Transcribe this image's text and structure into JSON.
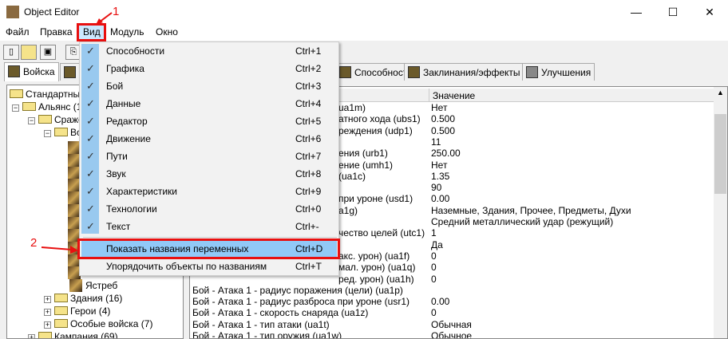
{
  "window": {
    "title": "Object Editor",
    "min": "—",
    "max": "☐",
    "close": "✕"
  },
  "menubar": [
    "Файл",
    "Правка",
    "Вид",
    "Модуль",
    "Окно"
  ],
  "annotations": {
    "one": "1",
    "two": "2"
  },
  "tabs": {
    "units": "Войска",
    "abilities": "Способности",
    "spells": "Заклинания/эффекты",
    "upgrades": "Улучшения"
  },
  "tree": {
    "root": "Стандартные",
    "alliance": "Альянс (1",
    "melee": "Сраже",
    "units": "Во",
    "hawk": "Ястреб",
    "buildings": "Здания (16)",
    "heroes": "Герои (4)",
    "special": "Особые войска (7)",
    "campaign": "Кампания (69)"
  },
  "menu": {
    "items": [
      {
        "label": "Способности",
        "shortcut": "Ctrl+1",
        "checked": true
      },
      {
        "label": "Графика",
        "shortcut": "Ctrl+2",
        "checked": true
      },
      {
        "label": "Бой",
        "shortcut": "Ctrl+3",
        "checked": true
      },
      {
        "label": "Данные",
        "shortcut": "Ctrl+4",
        "checked": true
      },
      {
        "label": "Редактор",
        "shortcut": "Ctrl+5",
        "checked": true
      },
      {
        "label": "Движение",
        "shortcut": "Ctrl+6",
        "checked": true
      },
      {
        "label": "Пути",
        "shortcut": "Ctrl+7",
        "checked": true
      },
      {
        "label": "Звук",
        "shortcut": "Ctrl+8",
        "checked": true
      },
      {
        "label": "Характеристики",
        "shortcut": "Ctrl+9",
        "checked": true
      },
      {
        "label": "Технологии",
        "shortcut": "Ctrl+0",
        "checked": true
      },
      {
        "label": "Текст",
        "shortcut": "Ctrl+-",
        "checked": true
      }
    ],
    "extra": [
      {
        "label": "Показать названия переменных",
        "shortcut": "Ctrl+D"
      },
      {
        "label": "Упорядочить объекты по названиям",
        "shortcut": "Ctrl+T"
      }
    ]
  },
  "grid": {
    "header_value": "Значение",
    "rows": [
      [
        "ua1m)",
        "Нет"
      ],
      [
        "атного хода (ubs1)",
        "0.500"
      ],
      [
        "реждения (udp1)",
        "0.500"
      ],
      [
        "",
        "11"
      ],
      [
        "ения (urb1)",
        "250.00"
      ],
      [
        "ение (umh1)",
        "Нет"
      ],
      [
        "(ua1c)",
        "1.35"
      ],
      [
        "",
        "90"
      ],
      [
        "при уроне (usd1)",
        "0.00"
      ],
      [
        "a1g)",
        "Наземные, Здания, Прочее, Предметы, Духи"
      ],
      [
        "",
        "Средний металлический удар (режущий)"
      ],
      [
        "чество целей (utc1)",
        "1"
      ],
      [
        "",
        "Да"
      ],
      [
        "акс. урон) (ua1f)",
        "0"
      ],
      [
        "мал. урон) (ua1q)",
        "0"
      ],
      [
        "ред. урон) (ua1h)",
        "0"
      ],
      [
        "Бой - Атака 1 - радиус поражения (цели) (ua1p)",
        ""
      ],
      [
        "Бой - Атака 1 - радиус разброса при уроне (usr1)",
        "0.00"
      ],
      [
        "Бой - Атака 1 - скорость снаряда (ua1z)",
        "0"
      ],
      [
        "Бой - Атака 1 - тип атаки (ua1t)",
        "Обычная"
      ],
      [
        "Бой - Атака 1 - тип оружия (ua1w)",
        "Обычное"
      ]
    ]
  }
}
